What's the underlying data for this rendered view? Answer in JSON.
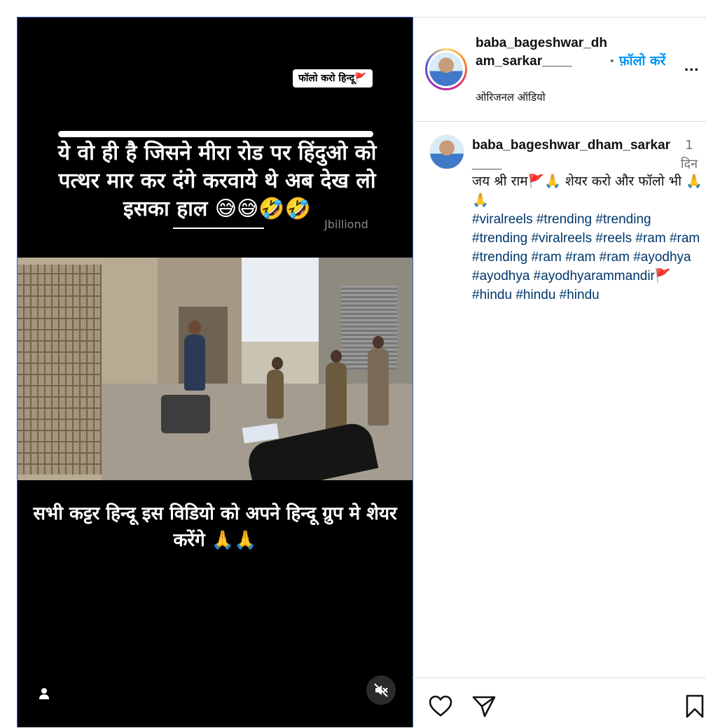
{
  "video": {
    "sticker": "फॉलो करो हिन्दू🚩",
    "top_caption": "ये वो ही है जिसने मीरा रोड पर हिंदुओ को पत्थर मार कर दंगे करवाये थे अब देख लो इसका हाल 😅😅🤣🤣",
    "watermark": "Jbilliond",
    "bottom_caption": "सभी कट्टर हिन्दू इस विडियो को अपने हिन्दू ग्रुप मे शेयर करेंगे 🙏🙏"
  },
  "header": {
    "username": "baba_bageshwar_dham_sarkar____",
    "separator": "•",
    "follow_label": "फ़ॉलो करें",
    "more": "...",
    "audio": "ओरिजनल ऑडियो"
  },
  "comment": {
    "username": "baba_bageshwar_dham_sarkar____",
    "time": "1 दिन",
    "text": "जय श्री राम🚩🙏 शेयर करो और फॉलो भी 🙏🙏",
    "hashtags": "#viralreels #trending #trending #trending #viralreels #reels #ram #ram #trending #ram #ram #ram #ayodhya #ayodhya #ayodhyarammandir🚩 #hindu #hindu #hindu"
  },
  "icons": {
    "like": "heart-icon",
    "share": "paper-plane-icon",
    "save": "bookmark-icon",
    "mute": "speaker-muted-icon",
    "user": "user-icon",
    "more": "more-options-icon"
  },
  "colors": {
    "link": "#0095f6",
    "hashtag": "#00376b",
    "video_bg": "#000000"
  }
}
